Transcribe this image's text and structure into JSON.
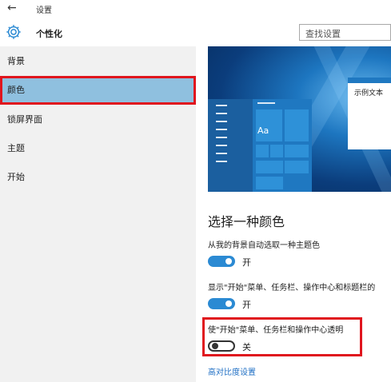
{
  "window": {
    "title": "设置"
  },
  "header": {
    "title": "个性化",
    "search_placeholder": "查找设置"
  },
  "sidebar": {
    "items": [
      {
        "label": "背景",
        "selected": false
      },
      {
        "label": "颜色",
        "selected": true
      },
      {
        "label": "锁屏界面",
        "selected": false
      },
      {
        "label": "主题",
        "selected": false
      },
      {
        "label": "开始",
        "selected": false
      }
    ]
  },
  "preview": {
    "tile_label": "Aa",
    "sample_text": "示例文本"
  },
  "main": {
    "heading": "选择一种颜色",
    "options": [
      {
        "label": "从我的背景自动选取一种主题色",
        "state": "on",
        "state_label": "开"
      },
      {
        "label": "显示\"开始\"菜单、任务栏、操作中心和标题栏的",
        "state": "on",
        "state_label": "开"
      },
      {
        "label": "使\"开始\"菜单、任务栏和操作中心透明",
        "state": "off",
        "state_label": "关"
      }
    ],
    "link": "高对比度设置"
  },
  "colors": {
    "accent": "#2b8ad3",
    "highlight_box": "#e0161e",
    "selected_nav": "#8fc0df",
    "link": "#1f6fc4"
  }
}
